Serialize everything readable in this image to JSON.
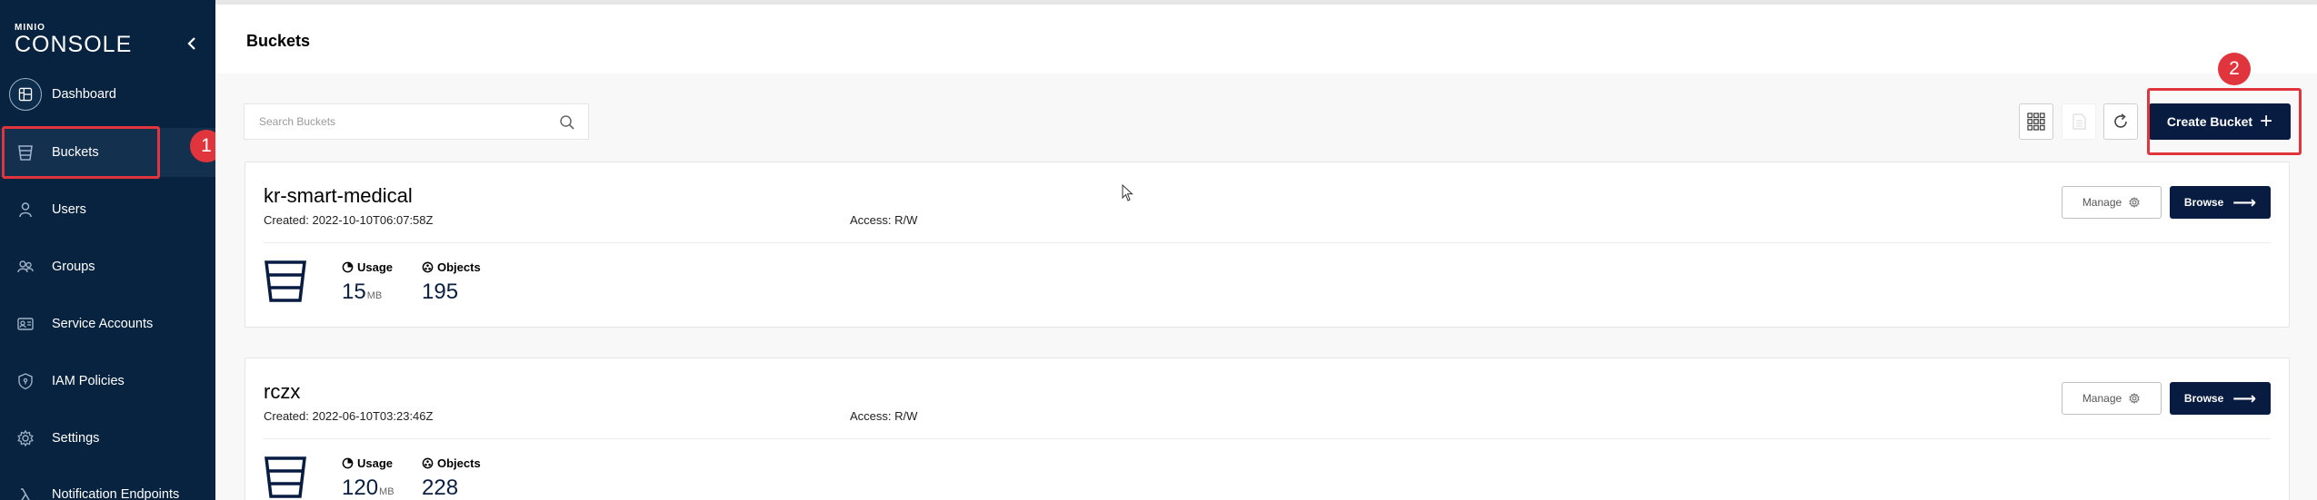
{
  "sidebar": {
    "logo_small": "MINIO",
    "logo_big": "CONSOLE",
    "collapse_icon": "chevron-left-icon",
    "items": [
      {
        "label": "Dashboard",
        "icon": "dashboard-icon"
      },
      {
        "label": "Buckets",
        "icon": "bucket-icon"
      },
      {
        "label": "Users",
        "icon": "user-icon"
      },
      {
        "label": "Groups",
        "icon": "groups-icon"
      },
      {
        "label": "Service Accounts",
        "icon": "service-accounts-icon"
      },
      {
        "label": "IAM Policies",
        "icon": "shield-icon"
      },
      {
        "label": "Settings",
        "icon": "gear-icon"
      },
      {
        "label": "Notification Endpoints",
        "icon": "lambda-icon"
      }
    ]
  },
  "annotations": [
    {
      "number": "1"
    },
    {
      "number": "2"
    }
  ],
  "header": {
    "title": "Buckets"
  },
  "toolbar": {
    "search_placeholder": "Search Buckets",
    "create_label": "Create Bucket",
    "buttons": [
      "grid-view-icon",
      "document-icon",
      "refresh-icon"
    ]
  },
  "buckets": [
    {
      "name": "kr-smart-medical",
      "created": "Created: 2022-10-10T06:07:58Z",
      "access": "Access: R/W",
      "usage_label": "Usage",
      "usage_value": "15",
      "usage_unit": "MB",
      "objects_label": "Objects",
      "objects_value": "195",
      "manage_label": "Manage",
      "browse_label": "Browse"
    },
    {
      "name": "rczx",
      "created": "Created: 2022-06-10T03:23:46Z",
      "access": "Access: R/W",
      "usage_label": "Usage",
      "usage_value": "120",
      "usage_unit": "MB",
      "objects_label": "Objects",
      "objects_value": "228",
      "manage_label": "Manage",
      "browse_label": "Browse"
    }
  ],
  "colors": {
    "sidebar_bg": "#08233f",
    "primary_button": "#081c42",
    "annotation_red": "#e0353c"
  }
}
